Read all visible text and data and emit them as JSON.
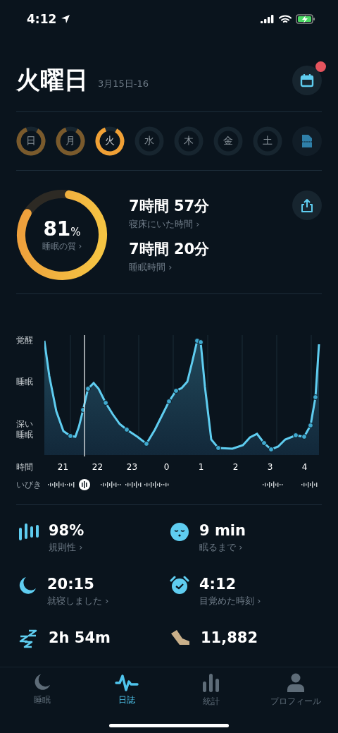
{
  "status_bar": {
    "time": "4:12"
  },
  "header": {
    "title": "火曜日",
    "date": "3月15日-16",
    "calendar_badge": true
  },
  "days": [
    {
      "label": "日",
      "recorded": true,
      "selected": false
    },
    {
      "label": "月",
      "recorded": true,
      "selected": false
    },
    {
      "label": "火",
      "recorded": true,
      "selected": true
    },
    {
      "label": "水",
      "recorded": false,
      "selected": false
    },
    {
      "label": "木",
      "recorded": false,
      "selected": false
    },
    {
      "label": "金",
      "recorded": false,
      "selected": false
    },
    {
      "label": "土",
      "recorded": false,
      "selected": false
    }
  ],
  "quality": {
    "value": "81",
    "unit": "%",
    "label": "睡眠の質 ›",
    "level": 0.81
  },
  "durations": [
    {
      "value": "7時間 57分",
      "label": "寝床にいた時間 ›"
    },
    {
      "value": "7時間 20分",
      "label": "睡眠時間 ›"
    }
  ],
  "sleep_chart": {
    "y_labels": [
      "覚醒",
      "睡眠",
      "深い睡眠"
    ],
    "x_title": "時間",
    "x_labels": [
      "21",
      "22",
      "23",
      "0",
      "1",
      "2",
      "3",
      "4"
    ],
    "snore_label": "いびき"
  },
  "metrics": [
    {
      "kind": "regularity",
      "value": "98%",
      "label": "規則性 ›"
    },
    {
      "kind": "fall-asleep",
      "value": "9 min",
      "label": "眠るまで ›"
    },
    {
      "kind": "bedtime",
      "value": "20:15",
      "label": "就寝しました ›"
    },
    {
      "kind": "wake",
      "value": "4:12",
      "label": "目覚めた時刻 ›"
    },
    {
      "kind": "snore",
      "value": "2h 54m"
    },
    {
      "kind": "steps",
      "value": "11,882"
    }
  ],
  "tab_bar": [
    {
      "kind": "sleep",
      "label": "睡眠",
      "selected": false
    },
    {
      "kind": "journal",
      "label": "日誌",
      "selected": true
    },
    {
      "kind": "stats",
      "label": "統計",
      "selected": false
    },
    {
      "kind": "profile",
      "label": "プロフィール",
      "selected": false
    }
  ]
}
